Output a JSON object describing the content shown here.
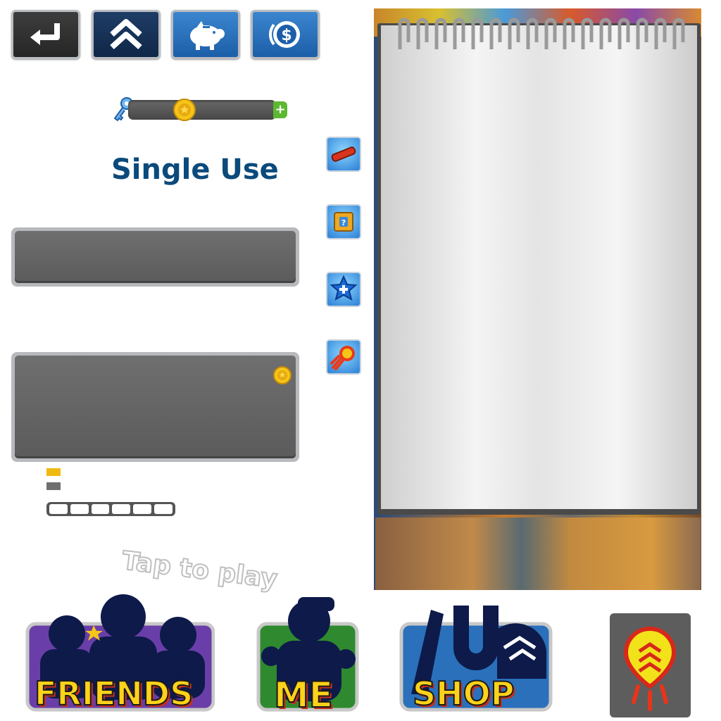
{
  "colors": {
    "title_blue": "#0b4a7c",
    "gold": "#efba10",
    "panel_gray": "#5f5f5f",
    "button_blue": "#2a70bb",
    "plus_green": "#5cb830"
  },
  "top_buttons": [
    {
      "icon": "back-arrow-icon"
    },
    {
      "icon": "double-chevron-up-icon"
    },
    {
      "icon": "piggy-bank-icon"
    },
    {
      "icon": "dollar-coin-icon"
    }
  ],
  "key_bar": {
    "icon": "key-icon",
    "coin_icon": "coin-icon",
    "plus_label": "+"
  },
  "section_title": "Single Use",
  "side_items": [
    {
      "icon": "hoverboard-icon"
    },
    {
      "icon": "mystery-box-icon"
    },
    {
      "icon": "star-plus-icon"
    },
    {
      "icon": "jetpack-rocket-icon"
    }
  ],
  "tap_to_play": "Tap to play",
  "bottom_menu": [
    {
      "label": "FRIENDS",
      "icon": "friends-silhouette-icon",
      "color": "#6a3ea8"
    },
    {
      "label": "ME",
      "icon": "me-silhouette-icon",
      "color": "#2f8a2f"
    },
    {
      "label": "SHOP",
      "icon": "shop-silhouette-icon",
      "color": "#2a70bb"
    }
  ],
  "boost_icon": "headstart-rocket-icon"
}
